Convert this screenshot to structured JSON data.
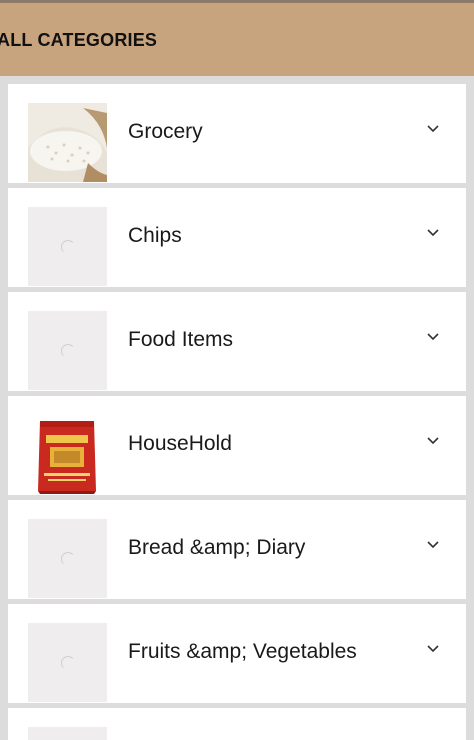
{
  "header": {
    "title": "ALL CATEGORIES"
  },
  "categories": [
    {
      "label": "Grocery",
      "image": "rice-sack"
    },
    {
      "label": "Chips",
      "image": "loading"
    },
    {
      "label": "Food Items",
      "image": "loading"
    },
    {
      "label": "HouseHold",
      "image": "red-flour-bag"
    },
    {
      "label": "Bread &amp; Diary",
      "image": "loading"
    },
    {
      "label": "Fruits &amp; Vegetables",
      "image": "loading"
    },
    {
      "label": "",
      "image": "loading"
    }
  ],
  "colors": {
    "header_bg": "#c8a47e",
    "page_bg": "#dcdcdc",
    "card_bg": "#ffffff"
  },
  "icons": {
    "expand": "chevron-down-icon"
  }
}
